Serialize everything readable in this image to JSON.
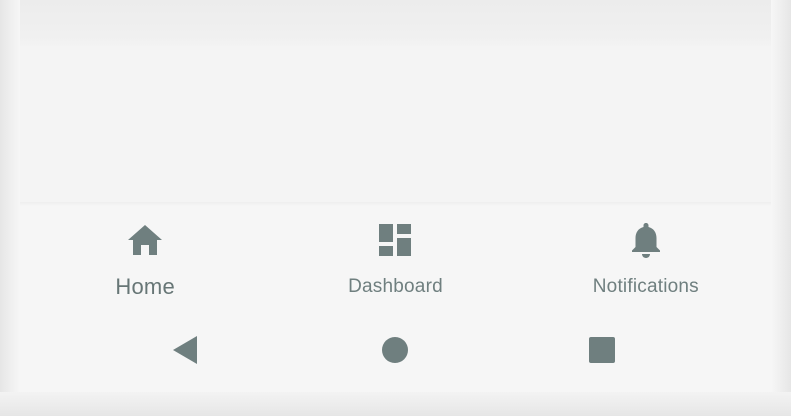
{
  "bottom_nav": {
    "items": [
      {
        "label": "Home",
        "icon": "home-icon",
        "active": true
      },
      {
        "label": "Dashboard",
        "icon": "dashboard-icon",
        "active": false
      },
      {
        "label": "Notifications",
        "icon": "bell-icon",
        "active": false
      }
    ]
  },
  "system_nav": {
    "buttons": [
      "back-icon",
      "home-circle-icon",
      "recents-icon"
    ]
  },
  "colors": {
    "icon": "#6f7f7f",
    "label": "#6f7f7f",
    "background": "#f5f5f5"
  }
}
